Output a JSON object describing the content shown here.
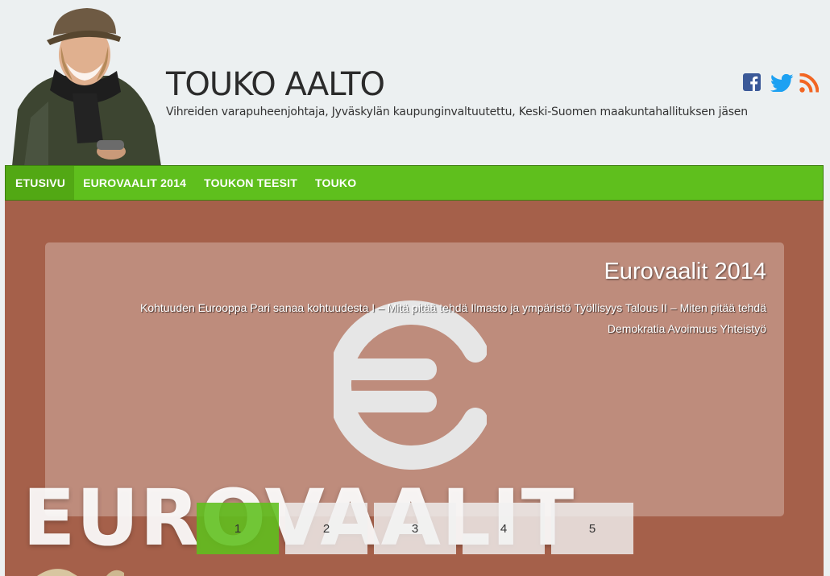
{
  "header": {
    "site_title": "TOUKO AALTO",
    "tagline": "Vihreiden varapuheenjohtaja, Jyväskylän kaupunginvaltuutettu, Keski-Suomen maakuntahallituksen jäsen",
    "social": [
      "facebook-icon",
      "twitter-icon",
      "rss-icon"
    ],
    "colors": {
      "facebook": "#3b5998",
      "twitter": "#1da1f2",
      "rss": "#f26522"
    }
  },
  "nav": {
    "items": [
      {
        "label": "ETUSIVU",
        "active": true
      },
      {
        "label": "EUROVAALIT 2014"
      },
      {
        "label": "TOUKON TEESIT"
      },
      {
        "label": "TOUKO"
      }
    ],
    "color": "#5fbf1d"
  },
  "slider": {
    "title": "Eurovaalit 2014",
    "links": [
      "Kohtuuden Eurooppa",
      "Pari sanaa kohtuudesta I – Mitä pitää tehdä",
      "Ilmasto ja ympäristö",
      "Työllisyys",
      "Talous II – Miten pitää tehdä",
      "Demokratia",
      "Avoimuus",
      "Yhteistyö"
    ],
    "big_word": "EUROVAALIT",
    "background_color": "#a5604a",
    "pager": [
      "1",
      "2",
      "3",
      "4",
      "5"
    ],
    "active_page": "1"
  }
}
